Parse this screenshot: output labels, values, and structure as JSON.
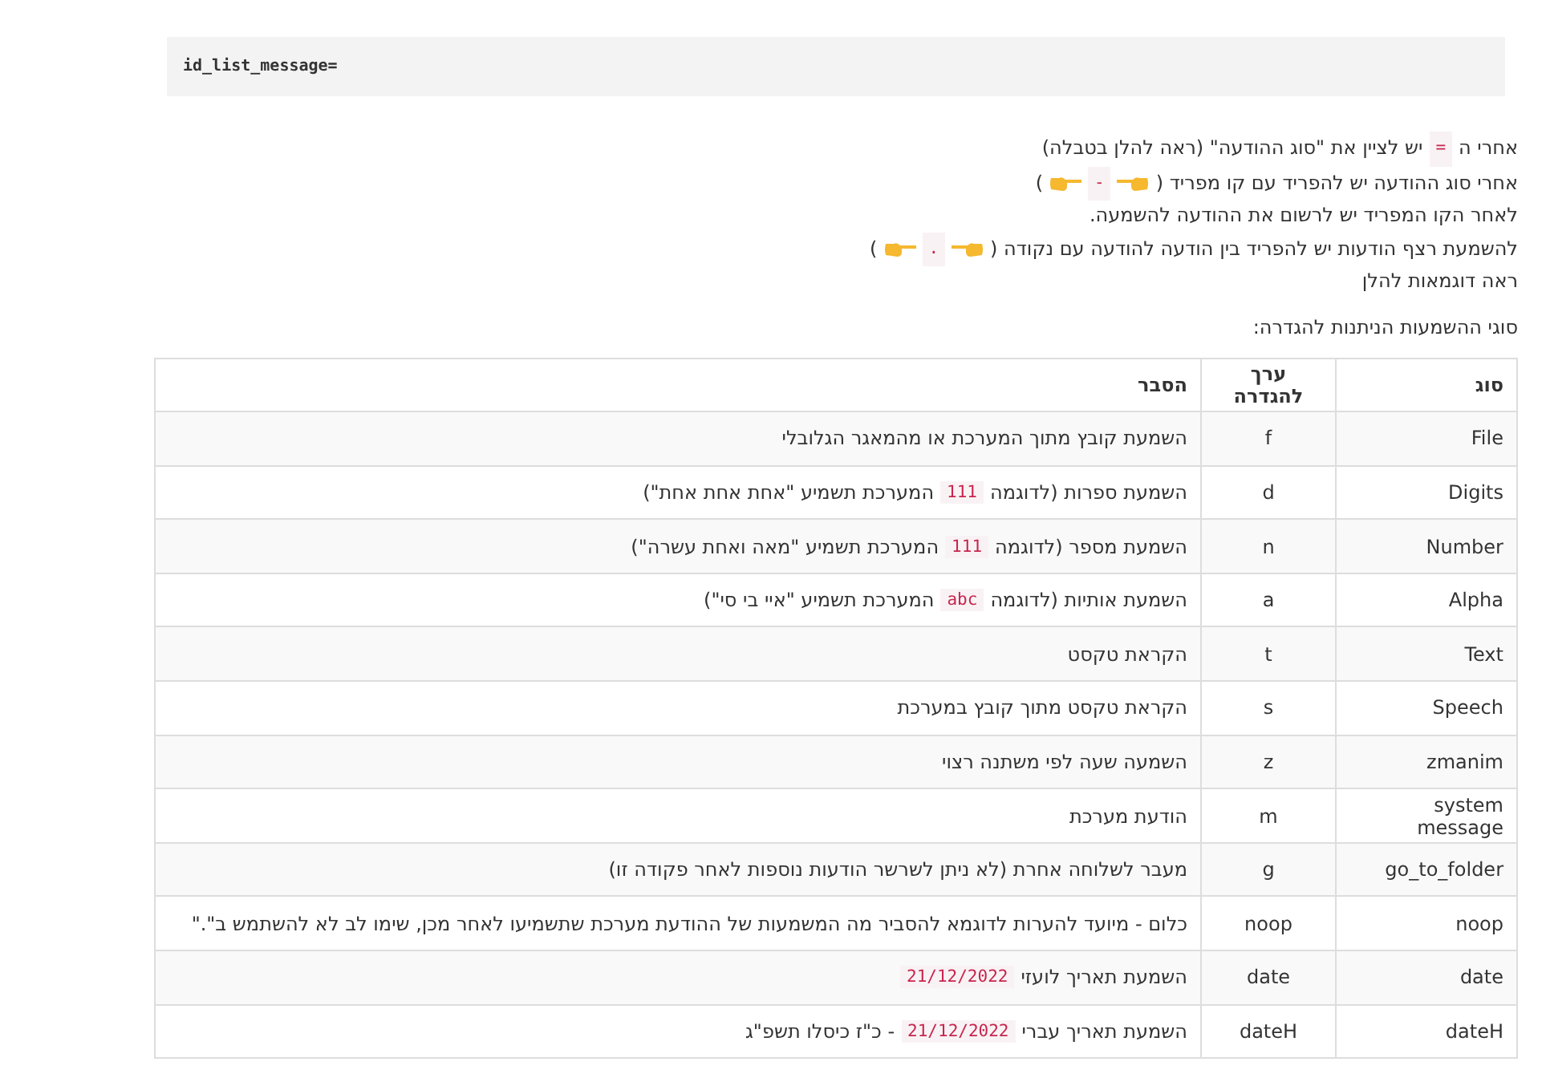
{
  "code_block": "id_list_message=",
  "instructions": [
    [
      {
        "kind": "text",
        "text": "אחרי ה"
      },
      {
        "kind": "code",
        "text": "="
      },
      {
        "kind": "text",
        "text": "יש לציין את \"סוג ההודעה\" (ראה להלן בטבלה)"
      }
    ],
    [
      {
        "kind": "text",
        "text": "אחרי סוג ההודעה יש להפריד עם קו מפריד ("
      },
      {
        "kind": "pointer-left"
      },
      {
        "kind": "code",
        "text": "-"
      },
      {
        "kind": "pointer-right"
      },
      {
        "kind": "text",
        "text": ")"
      }
    ],
    [
      {
        "kind": "text",
        "text": "לאחר הקו המפריד יש לרשום את ההודעה להשמעה."
      }
    ],
    [
      {
        "kind": "text",
        "text": "להשמעת רצף הודעות יש להפריד בין הודעה להודעה עם נקודה ("
      },
      {
        "kind": "pointer-left"
      },
      {
        "kind": "code",
        "text": "."
      },
      {
        "kind": "pointer-right"
      },
      {
        "kind": "text",
        "text": ")"
      }
    ],
    [
      {
        "kind": "text",
        "text": "ראה דוגמאות להלן"
      }
    ]
  ],
  "table_caption": "סוגי ההשמעות הניתנות להגדרה:",
  "table": {
    "columns": [
      "סוג",
      "ערך להגדרה",
      "הסבר"
    ],
    "rows": [
      {
        "type": "File",
        "value": "f",
        "explanation": [
          {
            "kind": "text",
            "text": "השמעת קובץ מתוך המערכת או מהמאגר הגלובלי"
          }
        ]
      },
      {
        "type": "Digits",
        "value": "d",
        "explanation": [
          {
            "kind": "text",
            "text": "השמעת ספרות (לדוגמה"
          },
          {
            "kind": "code",
            "text": "111"
          },
          {
            "kind": "text",
            "text": "המערכת תשמיע \"אחת אחת אחת\")"
          }
        ]
      },
      {
        "type": "Number",
        "value": "n",
        "explanation": [
          {
            "kind": "text",
            "text": "השמעת מספר (לדוגמה"
          },
          {
            "kind": "code",
            "text": "111"
          },
          {
            "kind": "text",
            "text": "המערכת תשמיע \"מאה ואחת עשרה\")"
          }
        ]
      },
      {
        "type": "Alpha",
        "value": "a",
        "explanation": [
          {
            "kind": "text",
            "text": "השמעת אותיות (לדוגמה"
          },
          {
            "kind": "code",
            "text": "abc"
          },
          {
            "kind": "text",
            "text": "המערכת תשמיע \"איי בי סי\")"
          }
        ]
      },
      {
        "type": "Text",
        "value": "t",
        "explanation": [
          {
            "kind": "text",
            "text": "הקראת טקסט"
          }
        ]
      },
      {
        "type": "Speech",
        "value": "s",
        "explanation": [
          {
            "kind": "text",
            "text": "הקראת טקסט מתוך קובץ במערכת"
          }
        ]
      },
      {
        "type": "zmanim",
        "value": "z",
        "explanation": [
          {
            "kind": "text",
            "text": "השמעה שעה לפי משתנה רצוי"
          }
        ]
      },
      {
        "type": "system message",
        "value": "m",
        "explanation": [
          {
            "kind": "text",
            "text": "הודעת מערכת"
          }
        ]
      },
      {
        "type": "go_to_folder",
        "value": "g",
        "explanation": [
          {
            "kind": "text",
            "text": "מעבר לשלוחה אחרת (לא ניתן לשרשר הודעות נוספות לאחר פקודה זו)"
          }
        ]
      },
      {
        "type": "noop",
        "value": "noop",
        "explanation": [
          {
            "kind": "text",
            "text": "כלום - מיועד להערות לדוגמא להסביר מה המשמעות של ההודעת מערכת שתשמיעו לאחר מכן, שימו לב לא להשתמש ב\".\""
          }
        ]
      },
      {
        "type": "date",
        "value": "date",
        "explanation": [
          {
            "kind": "text",
            "text": "השמעת תאריך לועזי"
          },
          {
            "kind": "code",
            "text": "21/12/2022"
          }
        ]
      },
      {
        "type": "dateH",
        "value": "dateH",
        "explanation": [
          {
            "kind": "text",
            "text": "השמעת תאריך עברי"
          },
          {
            "kind": "code",
            "text": "21/12/2022"
          },
          {
            "kind": "text",
            "text": "- כ\"ז כיסלו תשפ\"ג"
          }
        ]
      }
    ]
  }
}
